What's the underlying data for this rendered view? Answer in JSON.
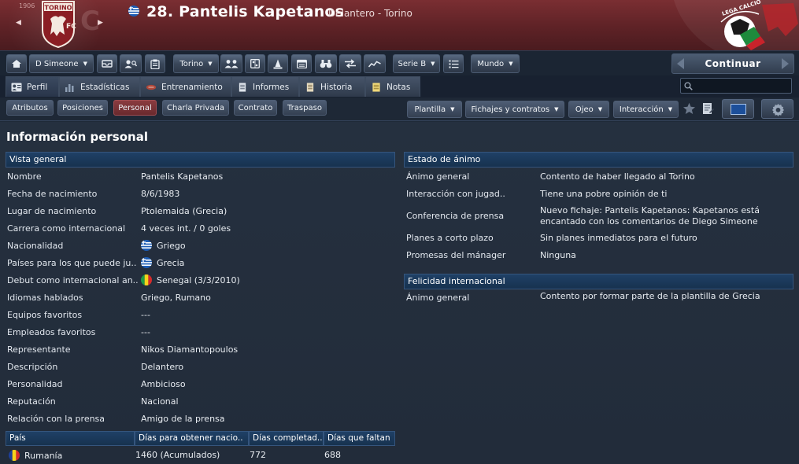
{
  "header": {
    "player_title": "28. Pantelis Kapetanos",
    "player_subtitle": "Delantero - Torino",
    "club_crest_text": "TORINO",
    "club_crest_sub": "FC",
    "club_founded": "1906",
    "league_logo_text": "LEGA CALCIO"
  },
  "toolbar": {
    "manager_label": "D Simeone",
    "club_label": "Torino",
    "league_label": "Serie B",
    "world_label": "Mundo",
    "continue_label": "Continuar"
  },
  "tabs": [
    {
      "label": "Perfil"
    },
    {
      "label": "Estadísticas"
    },
    {
      "label": "Entrenamiento"
    },
    {
      "label": "Informes"
    },
    {
      "label": "Historia"
    },
    {
      "label": "Notas"
    }
  ],
  "search": {
    "placeholder": ""
  },
  "subnav": {
    "items": [
      {
        "label": "Atributos"
      },
      {
        "label": "Posiciones"
      },
      {
        "label": "Personal"
      },
      {
        "label": "Charla Privada"
      },
      {
        "label": "Contrato"
      },
      {
        "label": "Traspaso"
      }
    ],
    "menus": [
      {
        "label": "Plantilla"
      },
      {
        "label": "Fichajes y contratos"
      },
      {
        "label": "Ojeo"
      },
      {
        "label": "Interacción"
      }
    ]
  },
  "main": {
    "title": "Información personal",
    "overview": {
      "heading": "Vista general",
      "rows": [
        {
          "label": "Nombre",
          "value": "Pantelis Kapetanos"
        },
        {
          "label": "Fecha de nacimiento",
          "value": "8/6/1983"
        },
        {
          "label": "Lugar de nacimiento",
          "value": "Ptolemaida (Grecia)"
        },
        {
          "label": "Carrera como internacional",
          "value": "4 veces int. / 0 goles"
        },
        {
          "label": "Nacionalidad",
          "value": "Griego"
        },
        {
          "label": "Países para los que puede ju..",
          "value": "Grecia"
        },
        {
          "label": "Debut como internacional an..",
          "value": "Senegal (3/3/2010)"
        },
        {
          "label": "Idiomas hablados",
          "value": "Griego, Rumano"
        },
        {
          "label": "Equipos favoritos",
          "value": "---"
        },
        {
          "label": "Empleados favoritos",
          "value": "---"
        },
        {
          "label": "Representante",
          "value": "Nikos Diamantopoulos"
        },
        {
          "label": "Descripción",
          "value": "Delantero"
        },
        {
          "label": "Personalidad",
          "value": "Ambicioso"
        },
        {
          "label": "Reputación",
          "value": "Nacional"
        },
        {
          "label": "Relación con la prensa",
          "value": "Amigo de la prensa"
        }
      ]
    },
    "mood": {
      "heading": "Estado de ánimo",
      "rows": [
        {
          "label": "Ánimo general",
          "value": "Contento de haber llegado al Torino"
        },
        {
          "label": "Interacción con jugad..",
          "value": "Tiene una pobre opinión de ti"
        },
        {
          "label": "Conferencia de prensa",
          "value": "Nuevo fichaje: Pantelis Kapetanos: Kapetanos está encantado con los comentarios de Diego Simeone"
        },
        {
          "label": "Planes a corto plazo",
          "value": "Sin planes inmediatos para el futuro"
        },
        {
          "label": "Promesas del mánager",
          "value": "Ninguna"
        }
      ]
    },
    "intl_happiness": {
      "heading": "Felicidad internacional",
      "rows": [
        {
          "label": "Ánimo general",
          "value": "Contento por formar parte de la plantilla de Grecia"
        }
      ]
    },
    "residency_table": {
      "columns": [
        "País",
        "Días para obtener nacio..",
        "Días completad..",
        "Días que faltan"
      ],
      "rows": [
        {
          "country": "Rumanía",
          "days_needed": "1460 (Acumulados)",
          "days_done": "772",
          "days_left": "688"
        }
      ]
    }
  },
  "colors": {
    "header_accent": "#6b272b",
    "section_header": "#1b3a5c",
    "active_pill": "#7d3338",
    "background": "#222c3a"
  }
}
